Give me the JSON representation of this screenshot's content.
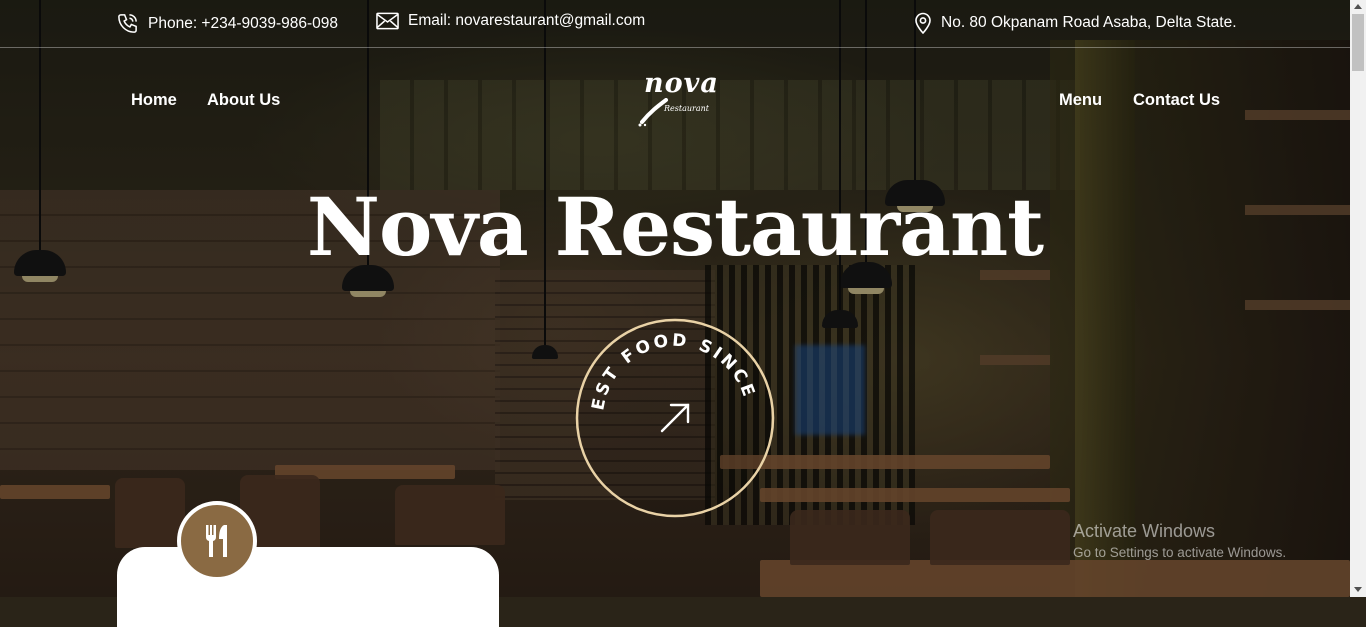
{
  "topbar": {
    "phone": "Phone: +234-9039-986-098",
    "email": "Email: novarestaurant@gmail.com",
    "address": "No. 80 Okpanam Road Asaba, Delta State."
  },
  "nav": {
    "home": "Home",
    "about": "About Us",
    "menu": "Menu",
    "contact": "Contact Us"
  },
  "logo": {
    "word": "nova",
    "sub": "Restaurant"
  },
  "hero": {
    "title": "Nova Restaurant",
    "badge_text": "BEST FOOD SINCE"
  },
  "watermark": {
    "title": "Activate Windows",
    "subtitle": "Go to Settings to activate Windows."
  },
  "colors": {
    "accent": "#8a6a43",
    "badge_ring": "#e9d2a6"
  },
  "icons": [
    "phone-icon",
    "mail-icon",
    "location-pin-icon",
    "arrow-up-right-icon",
    "utensils-icon"
  ]
}
